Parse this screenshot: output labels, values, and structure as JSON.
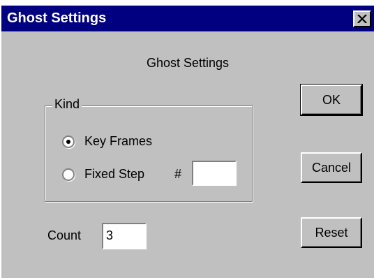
{
  "window": {
    "title": "Ghost Settings"
  },
  "dialog": {
    "heading": "Ghost Settings"
  },
  "kind_group": {
    "label": "Kind",
    "options": [
      {
        "label": "Key Frames",
        "checked": true
      },
      {
        "label": "Fixed Step",
        "checked": false
      }
    ],
    "step_label": "#",
    "step_value": ""
  },
  "count": {
    "label": "Count",
    "value": "3"
  },
  "buttons": {
    "ok": "OK",
    "cancel": "Cancel",
    "reset": "Reset"
  },
  "icons": {
    "close": "close-icon"
  }
}
